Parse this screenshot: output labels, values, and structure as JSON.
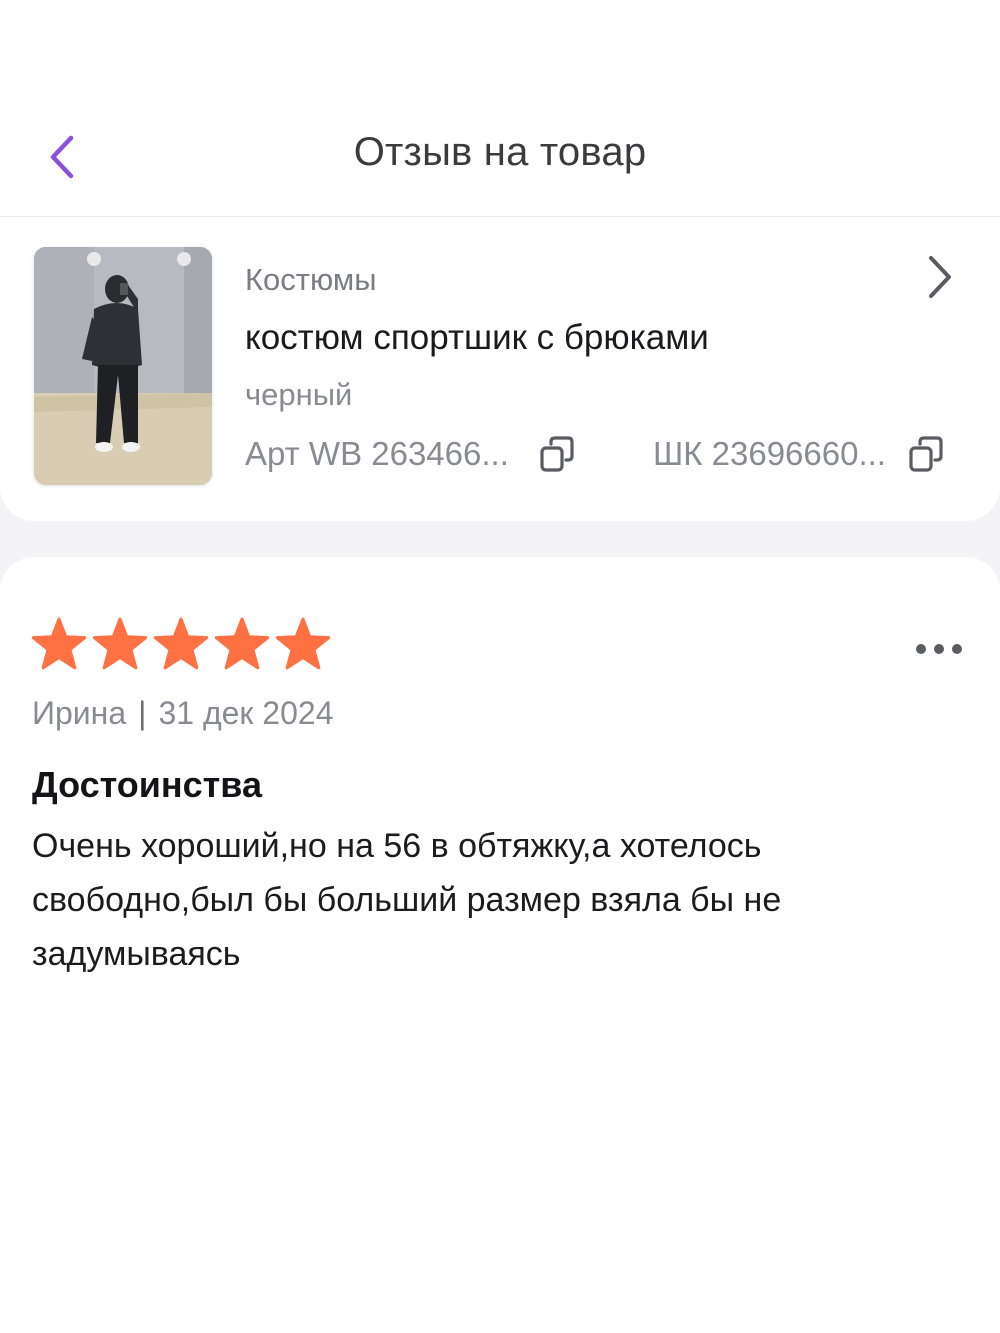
{
  "header": {
    "title": "Отзыв на товар",
    "back_icon": "chevron-left-icon"
  },
  "product": {
    "category": "Костюмы",
    "name": "костюм спортшик с брюками",
    "color": "черный",
    "art_label": "Арт WB 263466...",
    "shk_label": "ШК 23696660...",
    "copy_icon": "copy-icon",
    "chevron_icon": "chevron-right-icon"
  },
  "review": {
    "rating": 5,
    "max_rating": 5,
    "author": "Ирина",
    "separator": "|",
    "date": "31 дек 2024",
    "section_title": "Достоинства",
    "text": "Очень хороший,но на 56 в обтяжку,а хотелось свободно,был бы больший размер взяла бы не задумываясь",
    "more_icon": "more-dots-icon"
  },
  "colors": {
    "accent": "#8b4fe0",
    "star": "#ff7043",
    "secondary_text": "#8a8a92",
    "background": "#f4f4f6"
  }
}
